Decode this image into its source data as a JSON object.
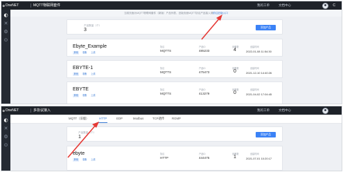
{
  "top_screen": {
    "logo": {
      "mark": "ᦞ",
      "text": "OneNET"
    },
    "app_name": "MQTT物联网套件",
    "top_links": [
      "我的工单",
      "文档中心"
    ],
    "avatar_badge": "C",
    "notice": {
      "text": "当前页面为MQTT物联网套件（新版）产品列表，旧版页面MQTT协议产品接入请",
      "link": "前往旧版入口"
    },
    "product_count_label": "产品数量（个）",
    "product_count": "3",
    "add_button_label": "添加产品",
    "column_labels": {
      "protocol": "协议",
      "product_id": "产品ID",
      "devices": "设备数",
      "created": "创建时间"
    },
    "tags": [
      "其他",
      "准备",
      "上线"
    ],
    "products": [
      {
        "name": "Ebyte_Example",
        "protocol": "MQTTS",
        "product_id": "485233",
        "devices": "4",
        "created": "2022-01-08 11:54:30"
      },
      {
        "name": "EBYTE-1",
        "protocol": "MQTTS",
        "product_id": "475473",
        "devices": "0",
        "created": "2021-12-10 14:40:26"
      },
      {
        "name": "EBYTE",
        "protocol": "MQTTS",
        "product_id": "413279",
        "devices": "0",
        "created": "2021-04-02 17:04:45"
      }
    ]
  },
  "bottom_screen": {
    "logo": {
      "mark": "ᦞ",
      "text": "OneNET"
    },
    "app_name": "多协议接入",
    "top_links": [
      "我的工单",
      "文档中心"
    ],
    "tabs": [
      "MQTT（旧版）",
      "HTTP",
      "EDP",
      "Modbus",
      "TCP透传",
      "RGMP"
    ],
    "active_tab": "HTTP",
    "product_count_label": "产品数量（个）",
    "product_count": "1",
    "add_button_label": "添加产品",
    "column_labels": {
      "protocol": "协议",
      "product_id": "产品ID",
      "devices": "设备数",
      "created": "创建时间"
    },
    "tags": [
      "其他",
      "准备",
      "上线"
    ],
    "products": [
      {
        "name": "ebyte",
        "protocol": "HTTP",
        "product_id": "444475",
        "devices": "1",
        "created": "2021-07-01 10:20:17"
      }
    ]
  },
  "colors": {
    "accent": "#3b82f6",
    "topbar": "#1e2229",
    "sidebar": "#252a33",
    "annotation_arrow": "#e53935"
  },
  "icons": [
    "logo-icon",
    "dashboard-icon",
    "tool-icon",
    "settings-icon",
    "user-avatar-icon"
  ]
}
